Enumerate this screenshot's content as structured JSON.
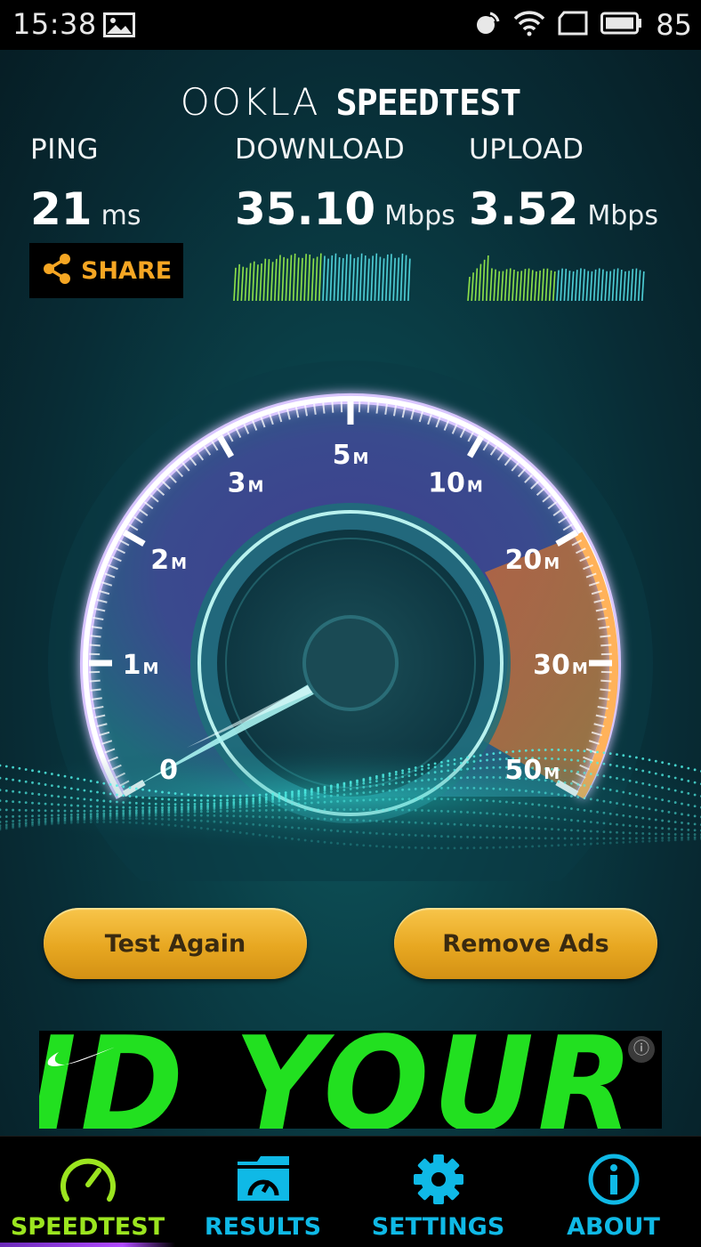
{
  "status_bar": {
    "time": "15:38",
    "battery_percent": "85"
  },
  "header": {
    "brand": "OOKLA",
    "product": "SPEEDTEST"
  },
  "results": {
    "ping": {
      "label": "PING",
      "value": "21",
      "unit": "ms"
    },
    "download": {
      "label": "DOWNLOAD",
      "value": "35.10",
      "unit": "Mbps"
    },
    "upload": {
      "label": "UPLOAD",
      "value": "3.52",
      "unit": "Mbps"
    }
  },
  "share_button": {
    "label": "SHARE"
  },
  "gauge": {
    "scale_labels": [
      "0",
      "1",
      "2",
      "3",
      "5",
      "10",
      "20",
      "30",
      "50"
    ],
    "unit_suffix": "M",
    "needle_value": "0"
  },
  "buttons": {
    "test_again": "Test Again",
    "remove_ads": "Remove Ads"
  },
  "ad": {
    "text": "ID YOUR F"
  },
  "nav": [
    {
      "label": "SPEEDTEST",
      "icon": "speedometer-icon",
      "active": true
    },
    {
      "label": "RESULTS",
      "icon": "folder-gauge-icon",
      "active": false
    },
    {
      "label": "SETTINGS",
      "icon": "gear-icon",
      "active": false
    },
    {
      "label": "ABOUT",
      "icon": "info-icon",
      "active": false
    }
  ],
  "colors": {
    "accent_orange": "#f5a623",
    "nav_blue": "#0fb9e6",
    "nav_active": "#9be51f",
    "ad_green": "#22e020",
    "button_gold": "#e7a721"
  }
}
